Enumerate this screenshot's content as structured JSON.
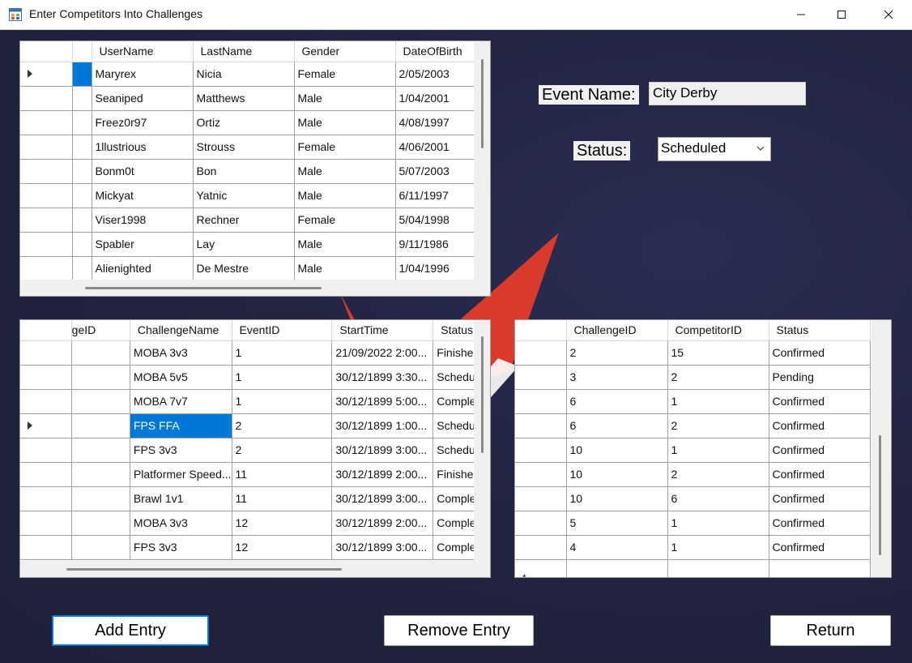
{
  "window": {
    "title": "Enter Competitors Into Challenges"
  },
  "competitors_grid": {
    "columns": [
      "UserName",
      "LastName",
      "Gender",
      "DateOfBirth"
    ],
    "rows": [
      [
        "Maryrex",
        "Nicia",
        "Female",
        "2/05/2003"
      ],
      [
        "Seaniped",
        "Matthews",
        "Male",
        "1/04/2001"
      ],
      [
        "Freez0r97",
        "Ortiz",
        "Male",
        "4/08/1997"
      ],
      [
        "1llustrious",
        "Strouss",
        "Female",
        "4/06/2001"
      ],
      [
        "Bonm0t",
        "Bon",
        "Male",
        "5/07/2003"
      ],
      [
        "Mickyat",
        "Yatnic",
        "Male",
        "6/11/1997"
      ],
      [
        "Viser1998",
        "Rechner",
        "Female",
        "5/04/1998"
      ],
      [
        "Spabler",
        "Lay",
        "Male",
        "9/11/1986"
      ],
      [
        "Alienighted",
        "De Mestre",
        "Male",
        "1/04/1996"
      ]
    ]
  },
  "challenges_grid": {
    "columns": [
      "geID",
      "ChallengeName",
      "EventID",
      "StartTime",
      "Status"
    ],
    "rows": [
      [
        "",
        "MOBA 3v3",
        "1",
        "21/09/2022 2:00...",
        "Finishe"
      ],
      [
        "",
        "MOBA 5v5",
        "1",
        "30/12/1899 3:30...",
        "Schedu"
      ],
      [
        "",
        "MOBA 7v7",
        "1",
        "30/12/1899 5:00...",
        "Comple"
      ],
      [
        "",
        "FPS FFA",
        "2",
        "30/12/1899 1:00...",
        "Schedu"
      ],
      [
        "",
        "FPS 3v3",
        "2",
        "30/12/1899 3:00...",
        "Schedu"
      ],
      [
        "",
        "Platformer Speed...",
        "11",
        "30/12/1899 2:00...",
        "Finishe"
      ],
      [
        "",
        "Brawl 1v1",
        "11",
        "30/12/1899 3:00...",
        "Comple"
      ],
      [
        "",
        "MOBA 3v3",
        "12",
        "30/12/1899 2:00...",
        "Comple"
      ],
      [
        "",
        "FPS 3v3",
        "12",
        "30/12/1899 3:00...",
        "Comple"
      ]
    ]
  },
  "entries_grid": {
    "columns": [
      "ChallengeID",
      "CompetitorID",
      "Status"
    ],
    "rows": [
      [
        "2",
        "15",
        "Confirmed"
      ],
      [
        "3",
        "2",
        "Pending"
      ],
      [
        "6",
        "1",
        "Confirmed"
      ],
      [
        "6",
        "2",
        "Confirmed"
      ],
      [
        "10",
        "1",
        "Confirmed"
      ],
      [
        "10",
        "2",
        "Confirmed"
      ],
      [
        "10",
        "6",
        "Confirmed"
      ],
      [
        "5",
        "1",
        "Confirmed"
      ],
      [
        "4",
        "1",
        "Confirmed"
      ]
    ],
    "new_row_marker": "*"
  },
  "form": {
    "event_name_label": "Event Name:",
    "event_name_value": "City Derby",
    "status_label": "Status:",
    "status_value": "Scheduled"
  },
  "buttons": {
    "add": "Add Entry",
    "remove": "Remove Entry",
    "return": "Return"
  },
  "colors": {
    "background": "#22233f",
    "selection": "#0078d7",
    "logo_red": "#d93a2b"
  }
}
